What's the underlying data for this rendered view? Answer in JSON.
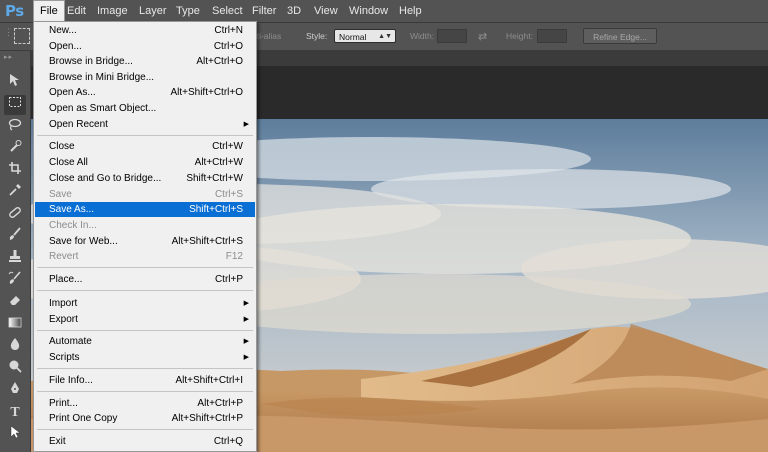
{
  "app": {
    "logo": "Ps"
  },
  "menubar": [
    {
      "label": "File",
      "active": true
    },
    {
      "label": "Edit"
    },
    {
      "label": "Image"
    },
    {
      "label": "Layer"
    },
    {
      "label": "Type"
    },
    {
      "label": "Select"
    },
    {
      "label": "Filter"
    },
    {
      "label": "3D"
    },
    {
      "label": "View"
    },
    {
      "label": "Window"
    },
    {
      "label": "Help"
    }
  ],
  "options_bar": {
    "antialias_label": "nti-alias",
    "style_label": "Style:",
    "style_value": "Normal",
    "width_label": "Width:",
    "height_label": "Height:",
    "refine_edge_label": "Refine Edge..."
  },
  "file_menu": {
    "items": [
      {
        "label": "New...",
        "shortcut": "Ctrl+N"
      },
      {
        "label": "Open...",
        "shortcut": "Ctrl+O"
      },
      {
        "label": "Browse in Bridge...",
        "shortcut": "Alt+Ctrl+O"
      },
      {
        "label": "Browse in Mini Bridge...",
        "shortcut": ""
      },
      {
        "label": "Open As...",
        "shortcut": "Alt+Shift+Ctrl+O"
      },
      {
        "label": "Open as Smart Object...",
        "shortcut": ""
      },
      {
        "label": "Open Recent",
        "shortcut": "",
        "submenu": true
      },
      {
        "label": "Close",
        "shortcut": "Ctrl+W"
      },
      {
        "label": "Close All",
        "shortcut": "Alt+Ctrl+W"
      },
      {
        "label": "Close and Go to Bridge...",
        "shortcut": "Shift+Ctrl+W"
      },
      {
        "label": "Save",
        "shortcut": "Ctrl+S",
        "disabled": true
      },
      {
        "label": "Save As...",
        "shortcut": "Shift+Ctrl+S",
        "highlighted": true
      },
      {
        "label": "Check In...",
        "shortcut": "",
        "disabled": true
      },
      {
        "label": "Save for Web...",
        "shortcut": "Alt+Shift+Ctrl+S"
      },
      {
        "label": "Revert",
        "shortcut": "F12",
        "disabled": true
      },
      {
        "label": "Place...",
        "shortcut": "Ctrl+P"
      },
      {
        "label": "Import",
        "shortcut": "",
        "submenu": true
      },
      {
        "label": "Export",
        "shortcut": "",
        "submenu": true
      },
      {
        "label": "Automate",
        "shortcut": "",
        "submenu": true
      },
      {
        "label": "Scripts",
        "shortcut": "",
        "submenu": true
      },
      {
        "label": "File Info...",
        "shortcut": "Alt+Shift+Ctrl+I"
      },
      {
        "label": "Print...",
        "shortcut": "Alt+Ctrl+P"
      },
      {
        "label": "Print One Copy",
        "shortcut": "Alt+Shift+Ctrl+P"
      },
      {
        "label": "Exit",
        "shortcut": "Ctrl+Q"
      }
    ]
  },
  "tools": [
    {
      "icon": "move-tool-icon"
    },
    {
      "icon": "rectangular-marquee-icon",
      "selected": true
    },
    {
      "icon": "lasso-icon"
    },
    {
      "icon": "quick-selection-icon"
    },
    {
      "icon": "crop-icon"
    },
    {
      "icon": "eyedropper-icon"
    },
    {
      "icon": "healing-brush-icon"
    },
    {
      "icon": "brush-icon"
    },
    {
      "icon": "clone-stamp-icon"
    },
    {
      "icon": "history-brush-icon"
    },
    {
      "icon": "eraser-icon"
    },
    {
      "icon": "gradient-icon"
    },
    {
      "icon": "blur-icon"
    },
    {
      "icon": "dodge-icon"
    },
    {
      "icon": "pen-icon"
    },
    {
      "icon": "type-tool-icon"
    },
    {
      "icon": "path-selection-icon"
    }
  ],
  "colors": {
    "menu_highlight": "#0a6fd4",
    "ui_panel": "#535353",
    "ps_logo": "#5da8e6"
  }
}
